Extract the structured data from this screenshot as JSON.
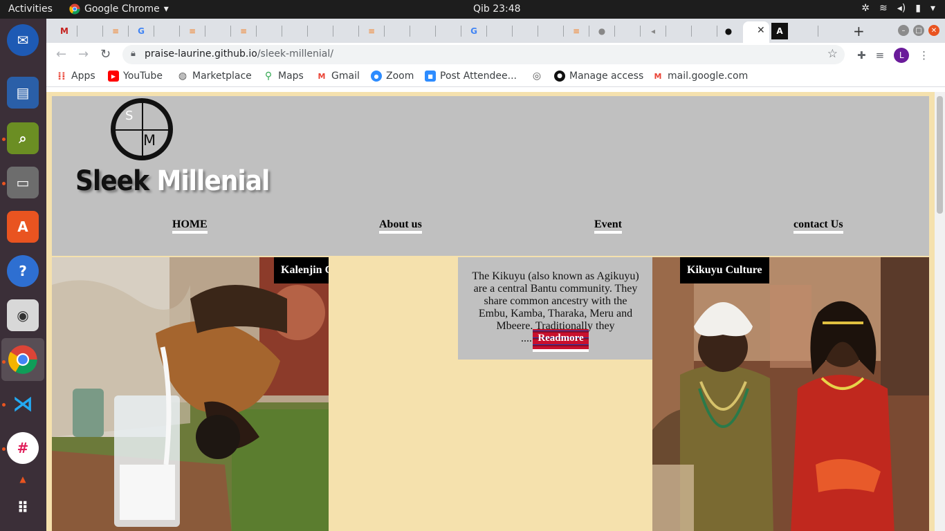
{
  "system_bar": {
    "activities": "Activities",
    "app_name": "Google Chrome",
    "clock": "Qib 23:48"
  },
  "browser": {
    "url_host": "praise-laurine.github.io",
    "url_path": "/sleek-millenial/",
    "profile_initial": "L",
    "bookmarks": [
      {
        "label": "Apps",
        "icon": "apps-grid-icon"
      },
      {
        "label": "YouTube",
        "icon": "youtube-icon"
      },
      {
        "label": "Marketplace",
        "icon": "globe-icon"
      },
      {
        "label": "Maps",
        "icon": "maps-pin-icon"
      },
      {
        "label": "Gmail",
        "icon": "gmail-icon"
      },
      {
        "label": "Zoom",
        "icon": "zoom-icon"
      },
      {
        "label": "Post Attendee...",
        "icon": "zoom-video-icon"
      },
      {
        "label": "",
        "icon": "circle-logo-icon"
      },
      {
        "label": "Manage access",
        "icon": "github-icon"
      },
      {
        "label": "mail.google.com",
        "icon": "gmail-icon"
      }
    ]
  },
  "site": {
    "logo": {
      "letter_top": "S",
      "letter_bottom": "M",
      "word1": "Sleek",
      "word2": "Millenial"
    },
    "nav": [
      "HOME",
      "About us",
      "Event",
      "contact Us"
    ],
    "kalenjin_label": "Kalenjin Culture",
    "kikuyu_label": "Kikuyu Culture",
    "description": "The Kikuyu (also known as Agikuyu) are a central Bantu community. They share common ancestry with the Embu, Kamba, Tharaka, Meru and Mbeere. Traditionally they",
    "ellipsis": "....",
    "read_more": "Readmore"
  },
  "colors": {
    "page_bg": "#f5e1ad",
    "header_bg": "#c0c0c0",
    "label_bg": "#000000"
  }
}
